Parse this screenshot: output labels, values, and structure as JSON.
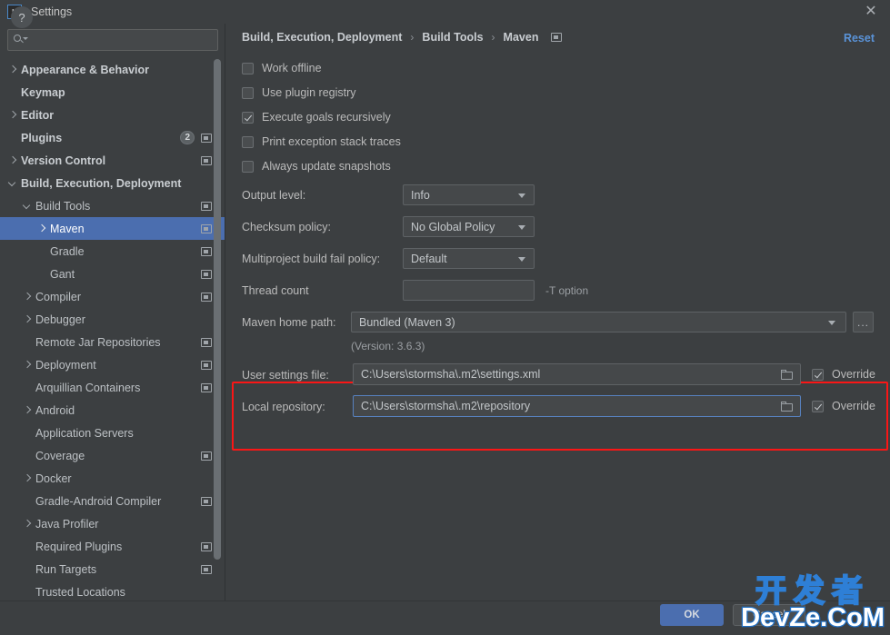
{
  "window": {
    "title": "Settings",
    "logo_text": "IJ",
    "close_icon": "close-icon"
  },
  "sidebar": {
    "search": {
      "placeholder": "",
      "value": ""
    },
    "items": [
      {
        "label": "Appearance & Behavior",
        "chevron": "right",
        "indent": 0,
        "bold": true,
        "selected": false,
        "panel_icon": false,
        "badge": ""
      },
      {
        "label": "Keymap",
        "chevron": "none",
        "indent": 0,
        "bold": true,
        "selected": false,
        "panel_icon": false,
        "badge": ""
      },
      {
        "label": "Editor",
        "chevron": "right",
        "indent": 0,
        "bold": true,
        "selected": false,
        "panel_icon": false,
        "badge": ""
      },
      {
        "label": "Plugins",
        "chevron": "none",
        "indent": 0,
        "bold": true,
        "selected": false,
        "panel_icon": true,
        "badge": "2"
      },
      {
        "label": "Version Control",
        "chevron": "right",
        "indent": 0,
        "bold": true,
        "selected": false,
        "panel_icon": true,
        "badge": ""
      },
      {
        "label": "Build, Execution, Deployment",
        "chevron": "down",
        "indent": 0,
        "bold": true,
        "selected": false,
        "panel_icon": false,
        "badge": ""
      },
      {
        "label": "Build Tools",
        "chevron": "down",
        "indent": 1,
        "bold": false,
        "selected": false,
        "panel_icon": true,
        "badge": ""
      },
      {
        "label": "Maven",
        "chevron": "right",
        "indent": 2,
        "bold": false,
        "selected": true,
        "panel_icon": true,
        "badge": ""
      },
      {
        "label": "Gradle",
        "chevron": "none",
        "indent": 2,
        "bold": false,
        "selected": false,
        "panel_icon": true,
        "badge": ""
      },
      {
        "label": "Gant",
        "chevron": "none",
        "indent": 2,
        "bold": false,
        "selected": false,
        "panel_icon": true,
        "badge": ""
      },
      {
        "label": "Compiler",
        "chevron": "right",
        "indent": 1,
        "bold": false,
        "selected": false,
        "panel_icon": true,
        "badge": ""
      },
      {
        "label": "Debugger",
        "chevron": "right",
        "indent": 1,
        "bold": false,
        "selected": false,
        "panel_icon": false,
        "badge": ""
      },
      {
        "label": "Remote Jar Repositories",
        "chevron": "none",
        "indent": 1,
        "bold": false,
        "selected": false,
        "panel_icon": true,
        "badge": ""
      },
      {
        "label": "Deployment",
        "chevron": "right",
        "indent": 1,
        "bold": false,
        "selected": false,
        "panel_icon": true,
        "badge": ""
      },
      {
        "label": "Arquillian Containers",
        "chevron": "none",
        "indent": 1,
        "bold": false,
        "selected": false,
        "panel_icon": true,
        "badge": ""
      },
      {
        "label": "Android",
        "chevron": "right",
        "indent": 1,
        "bold": false,
        "selected": false,
        "panel_icon": false,
        "badge": ""
      },
      {
        "label": "Application Servers",
        "chevron": "none",
        "indent": 1,
        "bold": false,
        "selected": false,
        "panel_icon": false,
        "badge": ""
      },
      {
        "label": "Coverage",
        "chevron": "none",
        "indent": 1,
        "bold": false,
        "selected": false,
        "panel_icon": true,
        "badge": ""
      },
      {
        "label": "Docker",
        "chevron": "right",
        "indent": 1,
        "bold": false,
        "selected": false,
        "panel_icon": false,
        "badge": ""
      },
      {
        "label": "Gradle-Android Compiler",
        "chevron": "none",
        "indent": 1,
        "bold": false,
        "selected": false,
        "panel_icon": true,
        "badge": ""
      },
      {
        "label": "Java Profiler",
        "chevron": "right",
        "indent": 1,
        "bold": false,
        "selected": false,
        "panel_icon": false,
        "badge": ""
      },
      {
        "label": "Required Plugins",
        "chevron": "none",
        "indent": 1,
        "bold": false,
        "selected": false,
        "panel_icon": true,
        "badge": ""
      },
      {
        "label": "Run Targets",
        "chevron": "none",
        "indent": 1,
        "bold": false,
        "selected": false,
        "panel_icon": true,
        "badge": ""
      },
      {
        "label": "Trusted Locations",
        "chevron": "none",
        "indent": 1,
        "bold": false,
        "selected": false,
        "panel_icon": false,
        "badge": ""
      }
    ]
  },
  "content": {
    "breadcrumb": {
      "part1": "Build, Execution, Deployment",
      "sep1": "›",
      "part2": "Build Tools",
      "sep2": "›",
      "part3": "Maven"
    },
    "reset_label": "Reset",
    "checkboxes": [
      {
        "label": "Work offline",
        "checked": false
      },
      {
        "label": "Use plugin registry",
        "checked": false
      },
      {
        "label": "Execute goals recursively",
        "checked": true
      },
      {
        "label": "Print exception stack traces",
        "checked": false
      },
      {
        "label": "Always update snapshots",
        "checked": false
      }
    ],
    "output_level": {
      "label": "Output level:",
      "value": "Info"
    },
    "checksum_policy": {
      "label": "Checksum policy:",
      "value": "No Global Policy"
    },
    "multiproject_policy": {
      "label": "Multiproject build fail policy:",
      "value": "Default"
    },
    "thread_count": {
      "label": "Thread count",
      "value": "",
      "hint": "-T option"
    },
    "maven_home": {
      "label": "Maven home path:",
      "value": "Bundled (Maven 3)",
      "version_note": "(Version: 3.6.3)",
      "browse_label": "..."
    },
    "user_settings": {
      "label": "User settings file:",
      "value": "C:\\Users\\stormsha\\.m2\\settings.xml",
      "override_label": "Override",
      "override_checked": true
    },
    "local_repository": {
      "label": "Local repository:",
      "value": "C:\\Users\\stormsha\\.m2\\repository",
      "override_label": "Override",
      "override_checked": true
    },
    "highlight_color": "#fa1616"
  },
  "footer": {
    "help_label": "?",
    "ok_label": "OK",
    "cancel_label": "Cancel"
  },
  "watermark": {
    "line1": "开发者",
    "line2": "DevZe.CoM"
  }
}
